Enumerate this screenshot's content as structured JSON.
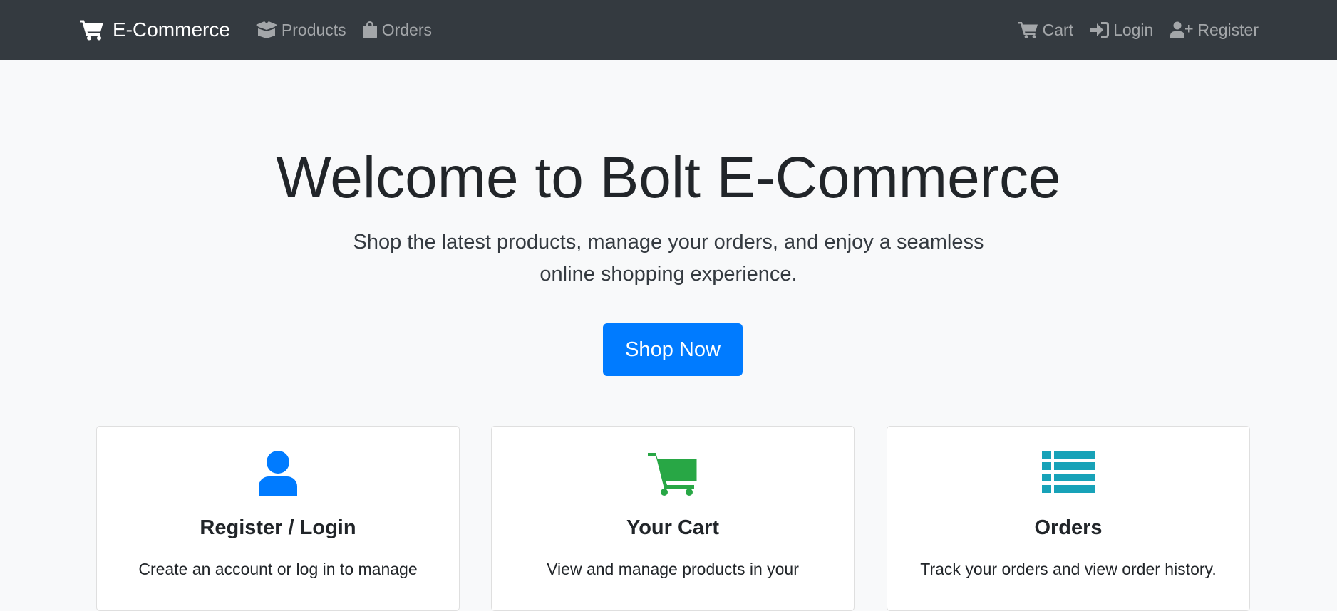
{
  "navbar": {
    "brand": "E-Commerce",
    "left_links": [
      {
        "label": "Products",
        "icon": "box-open-icon"
      },
      {
        "label": "Orders",
        "icon": "shopping-bag-icon"
      }
    ],
    "right_links": [
      {
        "label": "Cart",
        "icon": "cart-icon"
      },
      {
        "label": "Login",
        "icon": "sign-in-icon"
      },
      {
        "label": "Register",
        "icon": "user-plus-icon"
      }
    ]
  },
  "hero": {
    "title": "Welcome to Bolt E-Commerce",
    "subtitle": "Shop the latest products, manage your orders, and enjoy a seamless online shopping experience.",
    "cta_label": "Shop Now"
  },
  "cards": [
    {
      "icon": "user-icon",
      "icon_color": "#007bff",
      "title": "Register / Login",
      "text": "Create an account or log in to manage"
    },
    {
      "icon": "cart-icon",
      "icon_color": "#28a745",
      "title": "Your Cart",
      "text": "View and manage products in your"
    },
    {
      "icon": "list-icon",
      "icon_color": "#17a2b8",
      "title": "Orders",
      "text": "Track your orders and view order history."
    }
  ],
  "colors": {
    "navbar_bg": "#343a40",
    "primary": "#007bff",
    "success": "#28a745",
    "info": "#17a2b8",
    "page_bg": "#f8f9fa"
  }
}
